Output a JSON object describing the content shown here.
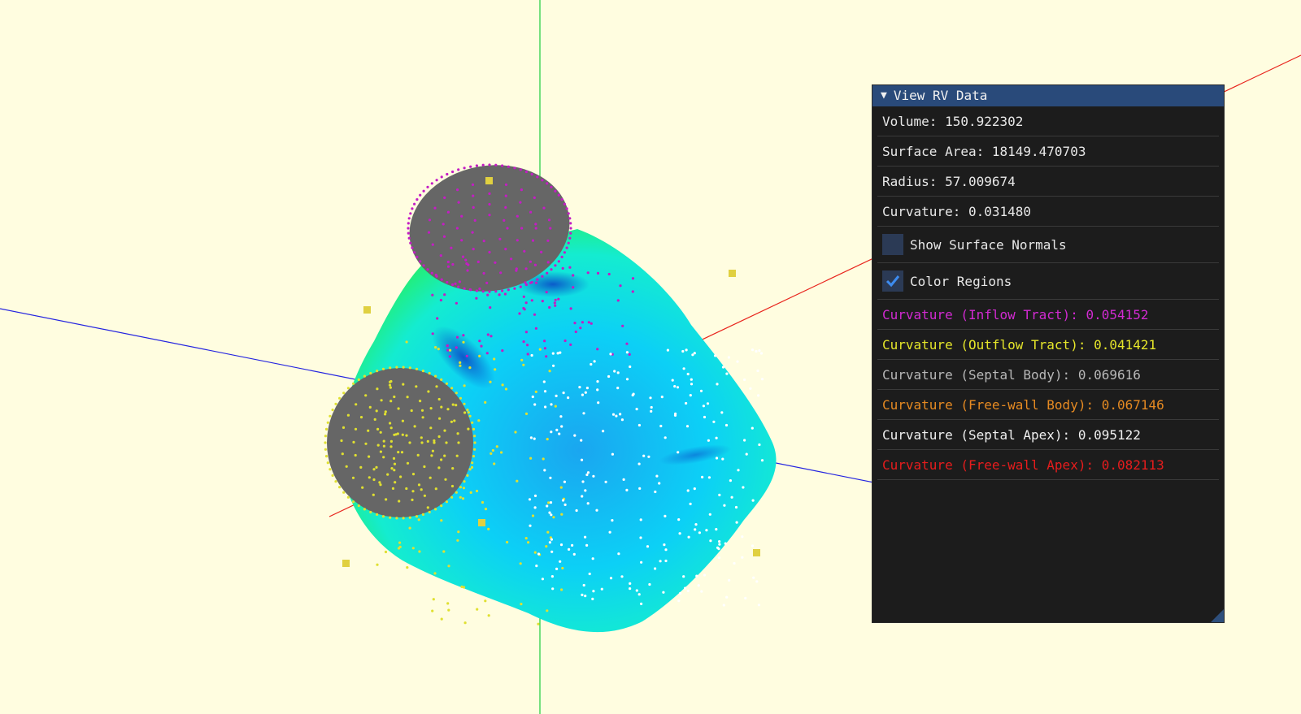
{
  "panel": {
    "title": "View RV Data",
    "collapse_icon": "triangle-down-icon",
    "stats": [
      {
        "key": "volume",
        "text": "Volume: 150.922302"
      },
      {
        "key": "surface-area",
        "text": "Surface Area: 18149.470703"
      },
      {
        "key": "radius",
        "text": "Radius: 57.009674"
      },
      {
        "key": "curvature",
        "text": "Curvature: 0.031480"
      }
    ],
    "checkboxes": [
      {
        "key": "show-surface-normals",
        "label": "Show Surface Normals",
        "checked": false
      },
      {
        "key": "color-regions",
        "label": "Color Regions",
        "checked": true
      }
    ],
    "regions": [
      {
        "key": "inflow-tract",
        "text": "Curvature (Inflow Tract): 0.054152",
        "color": "#d22ad2"
      },
      {
        "key": "outflow-tract",
        "text": "Curvature (Outflow Tract): 0.041421",
        "color": "#e6e62a"
      },
      {
        "key": "septal-body",
        "text": "Curvature (Septal Body): 0.069616",
        "color": "#b8b8b8"
      },
      {
        "key": "free-wall-body",
        "text": "Curvature (Free-wall Body): 0.067146",
        "color": "#e68a22"
      },
      {
        "key": "septal-apex",
        "text": "Curvature (Septal Apex): 0.095122",
        "color": "#f0f0f0"
      },
      {
        "key": "free-wall-apex",
        "text": "Curvature (Free-wall Apex): 0.082113",
        "color": "#e61c1c"
      }
    ]
  },
  "colors": {
    "background": "#fffde0",
    "axis_x": "#e8241c",
    "axis_y": "#1ccc3c",
    "axis_z": "#2424e0",
    "valve_cap": "#666666",
    "inflow_points": "#c41cc4",
    "outflow_points": "#e0e030",
    "body_points": "#ffffff",
    "landmark": "#e0d040"
  }
}
